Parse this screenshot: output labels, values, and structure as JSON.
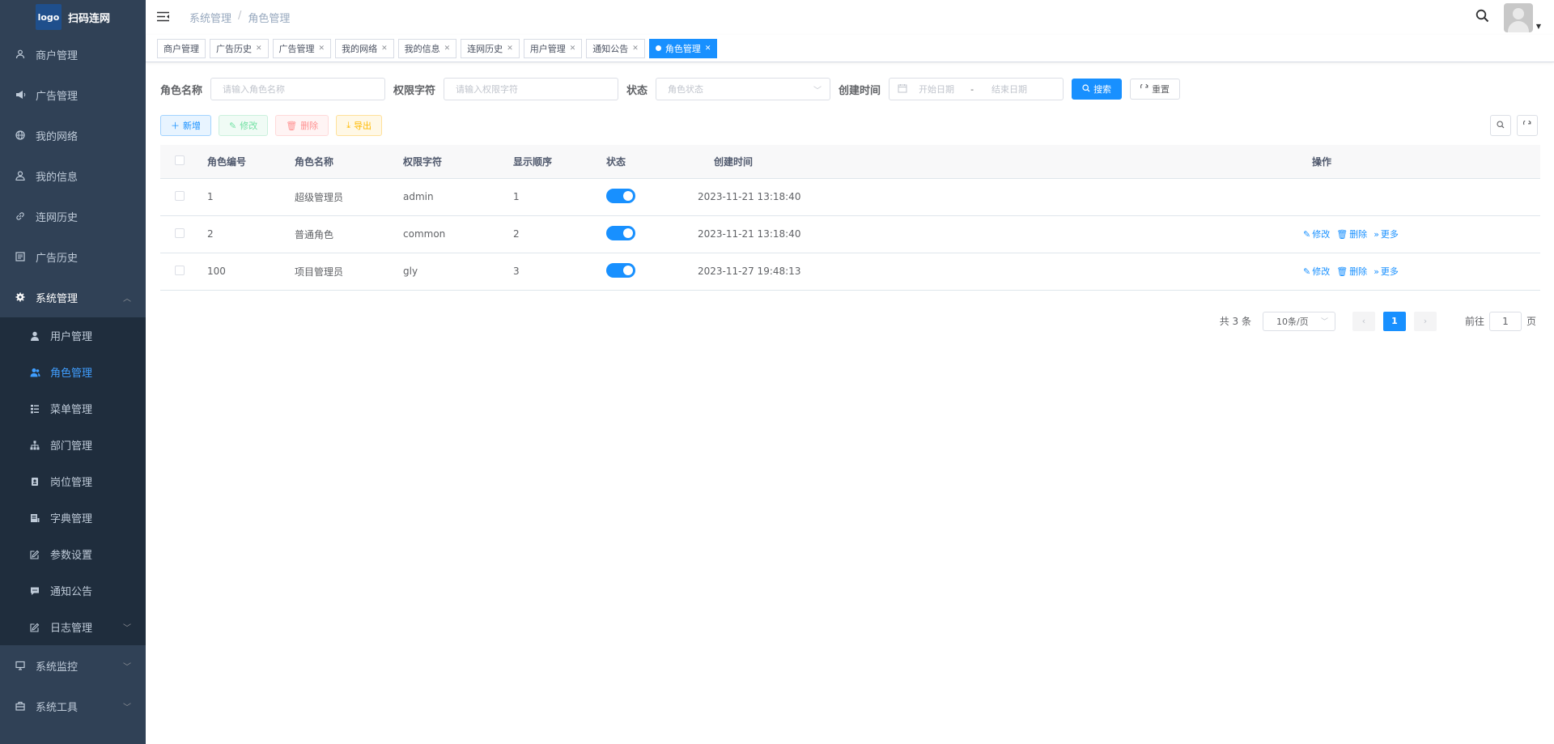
{
  "brand": {
    "logo": "logo",
    "name": "扫码连网"
  },
  "sidebar": {
    "items": [
      {
        "label": "商户管理",
        "icon": "merchant-icon"
      },
      {
        "label": "广告管理",
        "icon": "megaphone-icon"
      },
      {
        "label": "我的网络",
        "icon": "globe-icon"
      },
      {
        "label": "我的信息",
        "icon": "user-icon"
      },
      {
        "label": "连网历史",
        "icon": "link-icon"
      },
      {
        "label": "广告历史",
        "icon": "list-icon"
      },
      {
        "label": "系统管理",
        "icon": "gear-icon"
      }
    ],
    "system_sub": [
      {
        "label": "用户管理",
        "icon": "user-filled-icon"
      },
      {
        "label": "角色管理",
        "icon": "peoples-icon"
      },
      {
        "label": "菜单管理",
        "icon": "tree-table-icon"
      },
      {
        "label": "部门管理",
        "icon": "tree-icon"
      },
      {
        "label": "岗位管理",
        "icon": "post-icon"
      },
      {
        "label": "字典管理",
        "icon": "dict-icon"
      },
      {
        "label": "参数设置",
        "icon": "edit-icon"
      },
      {
        "label": "通知公告",
        "icon": "message-icon"
      },
      {
        "label": "日志管理",
        "icon": "log-icon"
      }
    ],
    "bottom": [
      {
        "label": "系统监控",
        "icon": "monitor-icon"
      },
      {
        "label": "系统工具",
        "icon": "tool-icon"
      }
    ]
  },
  "navbar": {
    "breadcrumb": [
      "系统管理",
      "角色管理"
    ]
  },
  "tags": [
    "商户管理",
    "广告历史",
    "广告管理",
    "我的网络",
    "我的信息",
    "连网历史",
    "用户管理",
    "通知公告",
    "角色管理"
  ],
  "search": {
    "role_name_label": "角色名称",
    "role_name_placeholder": "请输入角色名称",
    "role_key_label": "权限字符",
    "role_key_placeholder": "请输入权限字符",
    "status_label": "状态",
    "status_placeholder": "角色状态",
    "created_label": "创建时间",
    "start_placeholder": "开始日期",
    "range_sep": "-",
    "end_placeholder": "结束日期",
    "search_btn": "搜索",
    "reset_btn": "重置"
  },
  "toolbar": {
    "add": "新增",
    "edit": "修改",
    "delete": "删除",
    "export": "导出"
  },
  "table": {
    "headers": [
      "角色编号",
      "角色名称",
      "权限字符",
      "显示顺序",
      "状态",
      "创建时间",
      "操作"
    ],
    "rows": [
      {
        "id": "1",
        "name": "超级管理员",
        "key": "admin",
        "sort": "1",
        "enabled": true,
        "created": "2023-11-21 13:18:40",
        "ops": false
      },
      {
        "id": "2",
        "name": "普通角色",
        "key": "common",
        "sort": "2",
        "enabled": true,
        "created": "2023-11-21 13:18:40",
        "ops": true
      },
      {
        "id": "100",
        "name": "项目管理员",
        "key": "gly",
        "sort": "3",
        "enabled": true,
        "created": "2023-11-27 19:48:13",
        "ops": true
      }
    ],
    "op_edit": "修改",
    "op_delete": "删除",
    "op_more": "更多"
  },
  "pagination": {
    "total_text": "共 3 条",
    "page_size": "10条/页",
    "current": "1",
    "goto_label": "前往",
    "goto_value": "1",
    "page_unit": "页"
  },
  "colors": {
    "sidebar_bg": "#304156",
    "submenu_bg": "#1f2d3d",
    "primary": "#1890ff",
    "active_menu": "#409eff"
  }
}
